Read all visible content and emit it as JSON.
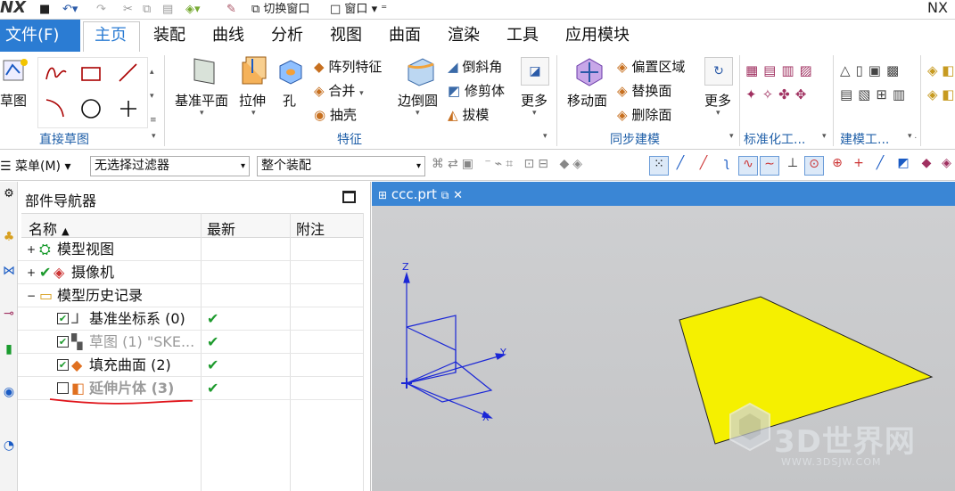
{
  "app": {
    "logo": "NX",
    "brand_right": "NX"
  },
  "quick_access": {
    "switch_window": "切换窗口",
    "window": "窗口"
  },
  "menu": {
    "file": "文件(F)",
    "tabs": [
      "主页",
      "装配",
      "曲线",
      "分析",
      "视图",
      "曲面",
      "渲染",
      "工具",
      "应用模块"
    ]
  },
  "ribbon": {
    "sketch": "草图",
    "group_direct_sketch": "直接草图",
    "datum_plane": "基准平面",
    "extrude": "拉伸",
    "hole": "孔",
    "pattern_feature": "阵列特征",
    "unite": "合并",
    "shell": "抽壳",
    "edge_blend": "边倒圆",
    "chamfer": "倒斜角",
    "trim_body": "修剪体",
    "draft": "拔模",
    "more": "更多",
    "group_feature": "特征",
    "move_face": "移动面",
    "offset_region": "偏置区域",
    "replace_face": "替换面",
    "delete_face": "删除面",
    "more2": "更多",
    "group_sync": "同步建模",
    "group_standard": "标准化工...",
    "group_modeling": "建模工..."
  },
  "toolbar2": {
    "menu": "菜单(M)",
    "filter": "无选择过滤器",
    "scope": "整个装配"
  },
  "navigator": {
    "title": "部件导航器",
    "columns": {
      "name": "名称",
      "latest": "最新",
      "note": "附注"
    },
    "rows": [
      {
        "label": "模型视图"
      },
      {
        "label": "摄像机"
      },
      {
        "label": "模型历史记录"
      },
      {
        "label": "基准坐标系 (0)",
        "latest": "✔"
      },
      {
        "label": "草图 (1) \"SKE...",
        "latest": "✔"
      },
      {
        "label": "填充曲面 (2)",
        "latest": "✔"
      },
      {
        "label": "延伸片体 (3)",
        "latest": "✔"
      }
    ]
  },
  "viewport": {
    "tab": "ccc.prt",
    "axes": {
      "z": "Z",
      "y": "Y",
      "x": "X"
    },
    "watermark_title": "3D世界网",
    "watermark_url": "WWW.3DSJW.COM"
  },
  "colors": {
    "accent": "#3a86d5",
    "surface": "#f5f000",
    "check": "#1e9b2e",
    "csys": "#1b27d6",
    "annotation": "#e0141a"
  }
}
